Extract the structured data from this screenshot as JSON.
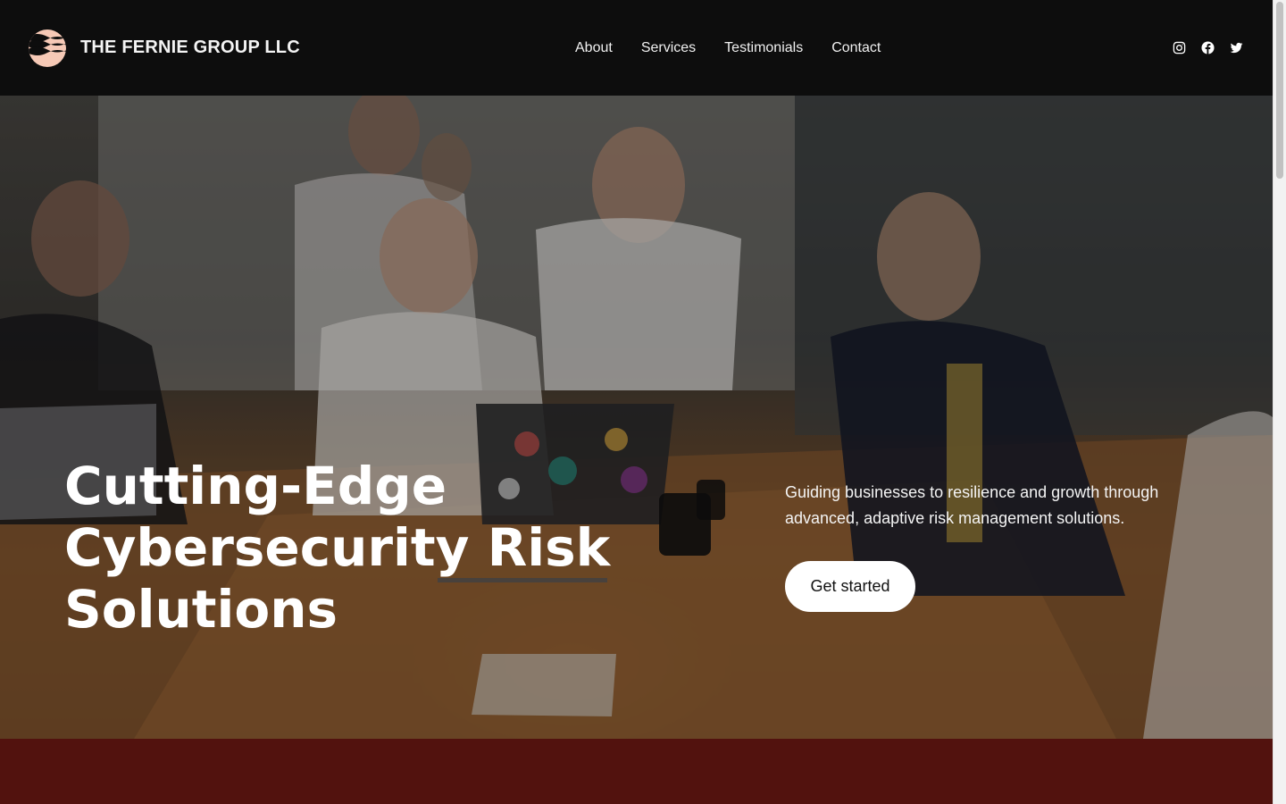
{
  "header": {
    "brand_name": "THE FERNIE GROUP LLC",
    "logo_icon": "wave-sun-logo",
    "nav": [
      {
        "label": "About"
      },
      {
        "label": "Services"
      },
      {
        "label": "Testimonials"
      },
      {
        "label": "Contact"
      }
    ],
    "socials": [
      {
        "icon": "instagram-icon"
      },
      {
        "icon": "facebook-icon"
      },
      {
        "icon": "twitter-icon"
      }
    ]
  },
  "hero": {
    "title": "Cutting-Edge Cybersecurity Risk Solutions",
    "subtitle": "Guiding businesses to resilience and growth through advanced, adaptive risk management solutions.",
    "cta_label": "Get started",
    "background_image": "team-meeting-photo"
  },
  "colors": {
    "header_bg": "#0d0d0d",
    "band_bg": "#52120e",
    "logo_accent": "#f6c9b6",
    "button_bg": "#ffffff"
  }
}
